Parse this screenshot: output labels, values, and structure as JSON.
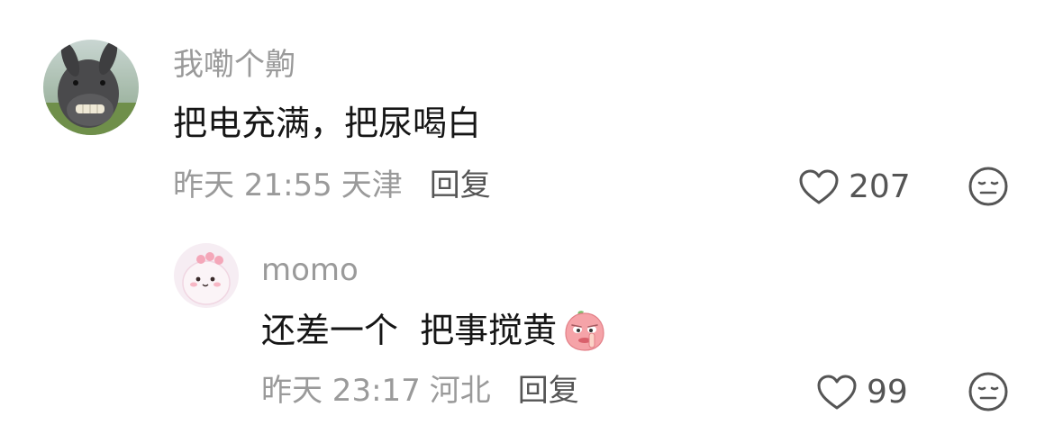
{
  "comments": [
    {
      "username": "我嘞个齁",
      "text": "把电充满，把尿喝白",
      "time": "昨天 21:55",
      "location": "天津",
      "reply_label": "回复",
      "likes": "207",
      "avatar_icon": "donkey-avatar"
    },
    {
      "username": "momo",
      "text": "还差一个  把事搅黄",
      "sticker_icon": "peach-shh-emoji",
      "time": "昨天 23:17",
      "location": "河北",
      "reply_label": "回复",
      "likes": "99",
      "avatar_icon": "cute-dino-avatar"
    }
  ],
  "colors": {
    "meta_gray": "#9a9a9a",
    "text_dark": "#161616",
    "icon_gray": "#555555"
  }
}
